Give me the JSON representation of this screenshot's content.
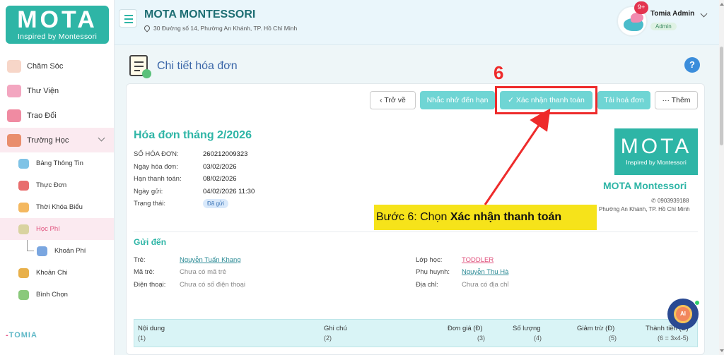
{
  "sidebar": {
    "logo_big": "MOTA",
    "logo_small": "Inspired by Montessori",
    "items": [
      {
        "label": "Chăm Sóc"
      },
      {
        "label": "Thư Viện"
      },
      {
        "label": "Trao Đổi"
      },
      {
        "label": "Trường Học"
      }
    ],
    "sub_items": [
      {
        "label": "Bảng Thông Tin"
      },
      {
        "label": "Thực Đơn"
      },
      {
        "label": "Thời Khóa Biểu"
      },
      {
        "label": "Học Phí"
      },
      {
        "label": "Khoản Phí"
      },
      {
        "label": "Khoản Chi"
      },
      {
        "label": "Bình Chọn"
      }
    ],
    "footer_brand": "TOMIA",
    "footer_prefix": "-"
  },
  "header": {
    "school_name": "MOTA MONTESSORI",
    "address": "30 Đường số 14, Phường An Khánh, TP. Hồ Chí Minh",
    "badge": "9+",
    "user_name": "Tomia Admin",
    "user_role": "Admin"
  },
  "page": {
    "title": "Chi tiết hóa đơn",
    "help": "?"
  },
  "toolbar": {
    "back": "‹  Trở về",
    "remind": "Nhắc nhở đến hạn",
    "confirm": "✓  Xác nhận thanh toán",
    "download": "Tải hoá đơn",
    "more": "···  Thêm"
  },
  "annotation": {
    "step_number": "6",
    "callout_prefix": "Bước 6: Chọn ",
    "callout_bold": "Xác nhận thanh toán"
  },
  "invoice": {
    "title": "Hóa đơn tháng 2/2026",
    "fields": [
      {
        "label": "SỐ HÓA ĐƠN:",
        "value": "260212009323"
      },
      {
        "label": "Ngày hóa đơn:",
        "value": "03/02/2026"
      },
      {
        "label": "Hạn thanh toán:",
        "value": "08/02/2026"
      },
      {
        "label": "Ngày gửi:",
        "value": "04/02/2026 11:30"
      },
      {
        "label": "Trạng thái:",
        "value": "Đã gửi"
      }
    ]
  },
  "brand": {
    "logo_big": "MOTA",
    "logo_small": "Inspired by Montessori",
    "name": "MOTA Montessori",
    "phone": "0903939188",
    "address": "Phường An Khánh, TP. Hồ Chí Minh"
  },
  "send_to": {
    "title": "Gửi đến",
    "left": [
      {
        "label": "Trẻ:",
        "value": "Nguyễn Tuấn Khang"
      },
      {
        "label": "Mã trẻ:",
        "value": "Chưa có mã trẻ"
      },
      {
        "label": "Điện thoại:",
        "value": "Chưa có số điện thoại"
      }
    ],
    "right": [
      {
        "label": "Lớp học:",
        "value": "TODDLER"
      },
      {
        "label": "Phụ huynh:",
        "value": "Nguyễn Thu Hà"
      },
      {
        "label": "Địa chỉ:",
        "value": "Chưa có địa chỉ"
      }
    ]
  },
  "table": {
    "columns": [
      {
        "label": "Nội dung",
        "sub": "(1)"
      },
      {
        "label": "Ghi chú",
        "sub": "(2)"
      },
      {
        "label": "Đơn giá (Đ)",
        "sub": "(3)"
      },
      {
        "label": "Số lượng",
        "sub": "(4)"
      },
      {
        "label": "Giảm trừ (Đ)",
        "sub": "(5)"
      },
      {
        "label": "Thành tiền (Đ)",
        "sub": "(6 = 3x4-5)"
      }
    ]
  },
  "ai": {
    "label": "AI"
  },
  "colors": {
    "accent": "#2eb5a6",
    "button": "#6fd5d4",
    "highlight": "#ee2b2b",
    "callout": "#f6e31a"
  }
}
